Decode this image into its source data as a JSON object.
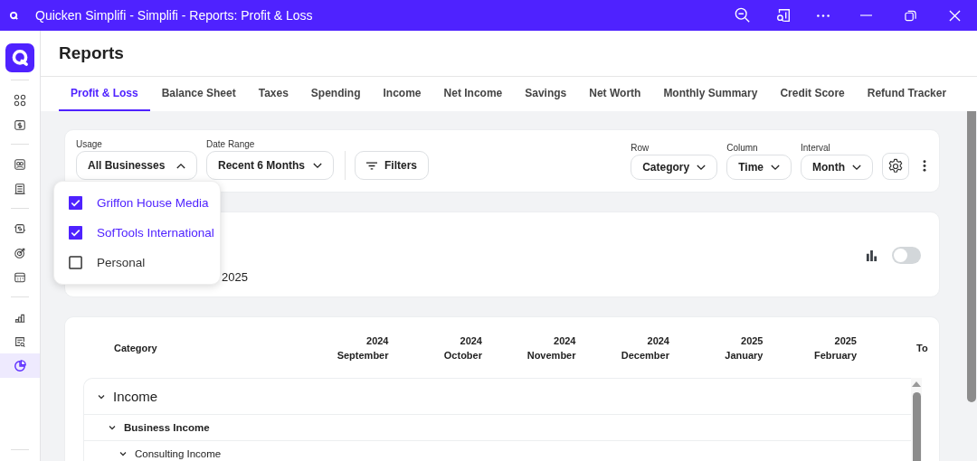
{
  "window": {
    "title": "Quicken Simplifi - Simplifi - Reports: Profit & Loss"
  },
  "sidebar": {
    "groups": [
      {
        "items": [
          {
            "selected": false
          },
          {
            "selected": false
          }
        ]
      },
      {
        "items": [
          {
            "selected": false
          },
          {
            "selected": false
          }
        ]
      },
      {
        "items": [
          {
            "selected": false
          },
          {
            "selected": false
          },
          {
            "selected": false
          }
        ]
      },
      {
        "items": [
          {
            "selected": false
          },
          {
            "selected": false
          },
          {
            "selected": true
          }
        ]
      }
    ]
  },
  "page_title": "Reports",
  "tabs": [
    {
      "label": "Profit & Loss",
      "selected": true
    },
    {
      "label": "Balance Sheet",
      "selected": false
    },
    {
      "label": "Taxes",
      "selected": false
    },
    {
      "label": "Spending",
      "selected": false
    },
    {
      "label": "Income",
      "selected": false
    },
    {
      "label": "Net Income",
      "selected": false
    },
    {
      "label": "Savings",
      "selected": false
    },
    {
      "label": "Net Worth",
      "selected": false
    },
    {
      "label": "Monthly Summary",
      "selected": false
    },
    {
      "label": "Credit Score",
      "selected": false
    },
    {
      "label": "Refund Tracker",
      "selected": false
    }
  ],
  "filters": {
    "usage": {
      "label": "Usage",
      "value": "All Businesses",
      "expanded": true,
      "options": [
        {
          "label": "Griffon House Media",
          "checked": true
        },
        {
          "label": "SofTools International",
          "checked": true
        },
        {
          "label": "Personal",
          "checked": false
        }
      ]
    },
    "date_range": {
      "label": "Date Range",
      "value": "Recent 6 Months"
    },
    "filters_button": "Filters",
    "row": {
      "label": "Row",
      "value": "Category"
    },
    "column": {
      "label": "Column",
      "value": "Time"
    },
    "interval": {
      "label": "Interval",
      "value": "Month"
    }
  },
  "summary": {
    "period_fragment": "2025",
    "chart_toggle": {
      "on": false
    }
  },
  "table": {
    "category_header": "Category",
    "total_header": "To",
    "columns": [
      {
        "year": "2024",
        "month": "September"
      },
      {
        "year": "2024",
        "month": "October"
      },
      {
        "year": "2024",
        "month": "November"
      },
      {
        "year": "2024",
        "month": "December"
      },
      {
        "year": "2025",
        "month": "January"
      },
      {
        "year": "2025",
        "month": "February"
      }
    ],
    "rows": [
      {
        "label": "Income",
        "expanded": true,
        "children": [
          {
            "label": "Business Income",
            "expanded": true,
            "children": [
              {
                "label": "Consulting Income",
                "expanded": true
              }
            ]
          }
        ]
      }
    ]
  }
}
